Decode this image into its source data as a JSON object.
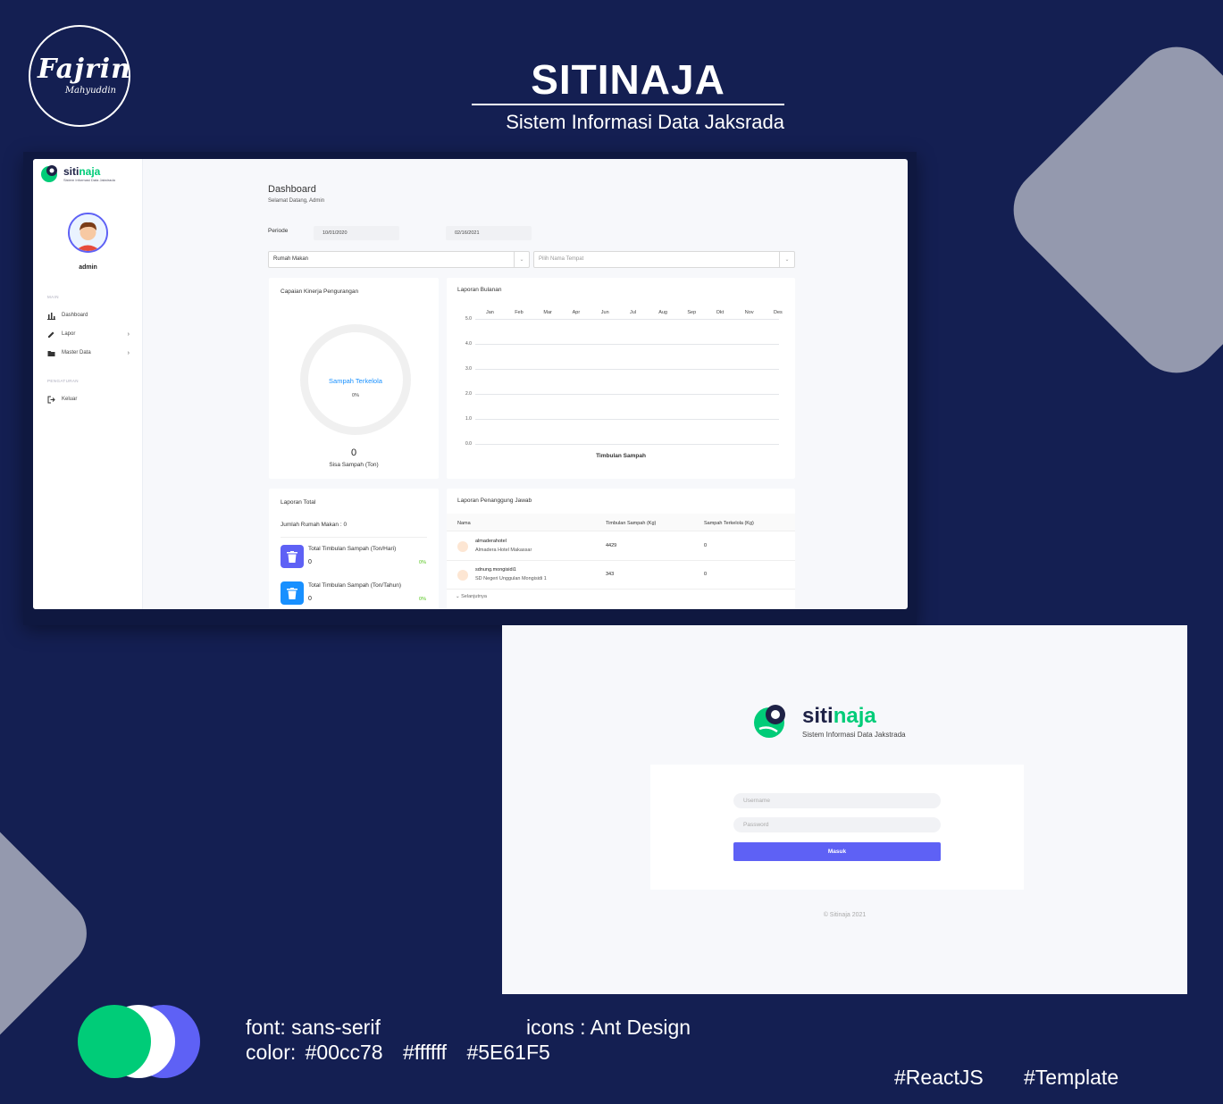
{
  "branding": {
    "signature": "Fajrin",
    "signature_sub": "Mahyuddin",
    "title": "SITINAJA",
    "subtitle": "Sistem Informasi Data Jaksrada"
  },
  "dashboard": {
    "logo": {
      "word_prefix": "siti",
      "word_accent": "naja",
      "tagline": "Sistem Informasi Data Jakstrada"
    },
    "user": {
      "name": "admin"
    },
    "nav": {
      "main_caption": "MAIN",
      "items": [
        {
          "label": "Dashboard",
          "icon": "bar-chart-icon"
        },
        {
          "label": "Lapor",
          "icon": "edit-icon"
        },
        {
          "label": "Master Data",
          "icon": "folder-icon"
        }
      ],
      "settings_caption": "PENGATURAN",
      "logout": {
        "label": "Keluar",
        "icon": "logout-icon"
      }
    },
    "header": {
      "title": "Dashboard",
      "subtitle": "Selamat Datang, Admin"
    },
    "filters": {
      "periode_label": "Periode",
      "date_start": "10/01/2020",
      "date_end": "02/16/2021",
      "category": "Rumah Makan",
      "place_placeholder": "Pilih Nama Tempat"
    },
    "kinerja": {
      "title": "Capaian Kinerja Pengurangan",
      "donut_label": "Sampah Terkelola",
      "donut_pct": "0%",
      "value": "0",
      "value_label": "Sisa Sampah (Ton)"
    },
    "laporan_bulanan": {
      "title": "Laporan Bulanan",
      "months": [
        "Jan",
        "Feb",
        "Mar",
        "Apr",
        "Jun",
        "Jul",
        "Aug",
        "Sep",
        "Okt",
        "Nov",
        "Des"
      ],
      "yticks": [
        "5.0",
        "4.0",
        "3.0",
        "2.0",
        "1.0",
        "0.0"
      ],
      "xlabel": "Timbulan Sampah"
    },
    "laporan_total": {
      "title": "Laporan Total",
      "jumlah": "Jumlah Rumah Makan : 0",
      "stats": [
        {
          "label": "Total Timbulan Sampah (Ton/Hari)",
          "value": "0",
          "pct": "0%",
          "color": "#5e61f5"
        },
        {
          "label": "Total Timbulan Sampah (Ton/Tahun)",
          "value": "0",
          "pct": "0%",
          "color": "#1890ff"
        }
      ]
    },
    "penanggung_jawab": {
      "title": "Laporan Penanggung Jawab",
      "columns": [
        "Nama",
        "Timbulan Sampah (Kg)",
        "Sampah Terkelola (Kg)"
      ],
      "rows": [
        {
          "username": "almaderahotel",
          "place": "Almadera Hotel Makassar",
          "timbulan": "4429",
          "terkelola": "0"
        },
        {
          "username": "sdnung.mongisidi1",
          "place": "SD Negeri Unggulan Mongisidi 1",
          "timbulan": "343",
          "terkelola": "0"
        }
      ],
      "next_label": "Selanjutnya"
    }
  },
  "chart_data": {
    "type": "line",
    "title": "Laporan Bulanan",
    "categories": [
      "Jan",
      "Feb",
      "Mar",
      "Apr",
      "Jun",
      "Jul",
      "Aug",
      "Sep",
      "Okt",
      "Nov",
      "Des"
    ],
    "series": [],
    "xlabel": "Timbulan Sampah",
    "ylabel": "",
    "ylim": [
      0,
      5
    ],
    "yticks": [
      0,
      1,
      2,
      3,
      4,
      5
    ],
    "grid": true
  },
  "login": {
    "logo": {
      "word_prefix": "siti",
      "word_accent": "naja",
      "tagline": "Sistem Informasi Data Jakstrada"
    },
    "username_placeholder": "Username",
    "password_placeholder": "Password",
    "submit_label": "Masuk",
    "footer": "© Sitinaja 2021"
  },
  "specs": {
    "font": "font: sans-serif",
    "icons": "icons : Ant Design",
    "color_prefix": "color:",
    "colors": [
      "#00cc78",
      "#ffffff",
      "#5E61F5"
    ],
    "tags": [
      "#ReactJS",
      "#Template"
    ]
  }
}
